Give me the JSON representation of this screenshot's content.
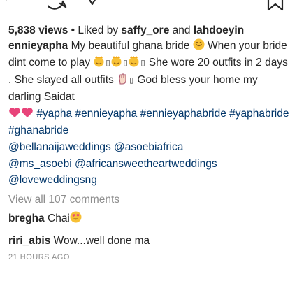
{
  "post": {
    "views": "5,838 views",
    "liked_sep": " • Liked by ",
    "liked_user1": "saffy_ore",
    "liked_and": " and ",
    "liked_user2": "lahdoeyin",
    "author": "ennieyapha",
    "caption": {
      "line1": "My beautiful ghana bride ",
      "line2a": "When your bride dint come to play ",
      "box_glyph": "▯",
      "line2b": "She wore 20 outfits in 2 days . She slayed all outfits ",
      "line3": "God bless your home my darling Saidat",
      "hashtags": [
        "#yapha",
        "#ennieyapha",
        "#ennieyaphabride",
        "#yaphabride",
        "#ghanabride"
      ],
      "mentions": [
        "@bellanaijaweddings",
        "@asoebiafrica",
        "@ms_asoebi",
        "@africansweetheartweddings",
        "@loveweddingsng"
      ]
    },
    "view_all_comments": "View all 107 comments",
    "comments": [
      {
        "user": "bregha",
        "text": "Chai"
      },
      {
        "user": "riri_abis",
        "text": "Wow...well done ma"
      }
    ],
    "timestamp": "21 HOURS AGO",
    "icons": [
      "heart-icon",
      "comment-icon",
      "share-icon",
      "bookmark-icon",
      "smiling-face-icon",
      "crowned-face-icon",
      "raised-hand-icon",
      "heart-emoji-icon",
      "heart-eyes-face-icon"
    ],
    "colors": {
      "text": "#262626",
      "hashtag": "#003569",
      "muted": "#8e8e8e",
      "emoji_yellow": "#f7c035",
      "heart_pink": "#e8447a"
    }
  }
}
